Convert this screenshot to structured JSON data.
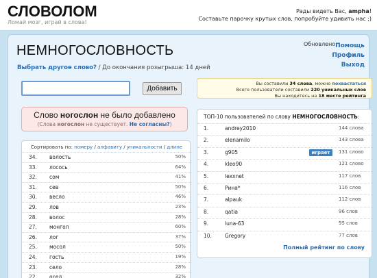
{
  "header": {
    "logo": "СЛОВОЛОМ",
    "slogan": "Ломай мозг, играй в слова!",
    "greet_line1": "Рады видеть Вас, ",
    "greet_user": "ampha",
    "greet_line1_end": "!",
    "greet_line2": "Составьте парочку крутых слов, попробуйте удивить нас ;)"
  },
  "game": {
    "word": "НЕМНОГОСЛОВНОСТЬ",
    "updated": "Обновлено",
    "links": [
      "Помощь",
      "Профиль",
      "Выход"
    ],
    "choose_other": "Выбрать другое слово?",
    "deadline": " / До окончания розыгрыша: 14 дней"
  },
  "input": {
    "value": "",
    "button_label": "Добавить"
  },
  "stats": {
    "line1_pre": "Вы составили ",
    "line1_count": "34 слова",
    "line1_mid": ", можно ",
    "line1_link": "похвастаться",
    "line2_pre": "Всего пользователи составили ",
    "line2_count": "220 уникальных слов",
    "line3_pre": "Вы находитесь на ",
    "line3_place": "18 месте рейтинга"
  },
  "error": {
    "pre": "Слово ",
    "word": "ногослон",
    "post": " не было добавлено",
    "sub_pre": "(Слова ",
    "sub_word": "ногослон",
    "sub_mid": " не существует. ",
    "sub_link": "Не согласны?",
    "sub_end": ")"
  },
  "sort": {
    "label": "Сортировать по: ",
    "options": [
      "номеру",
      "алфавиту",
      "уникальности",
      "длине"
    ],
    "sep": " / "
  },
  "words": [
    {
      "n": "34.",
      "w": "волость",
      "p": "50%"
    },
    {
      "n": "33.",
      "w": "лосось",
      "p": "64%"
    },
    {
      "n": "32.",
      "w": "сом",
      "p": "41%"
    },
    {
      "n": "31.",
      "w": "сев",
      "p": "50%"
    },
    {
      "n": "30.",
      "w": "весло",
      "p": "46%"
    },
    {
      "n": "29.",
      "w": "лов",
      "p": "23%"
    },
    {
      "n": "28.",
      "w": "волос",
      "p": "28%"
    },
    {
      "n": "27.",
      "w": "монгол",
      "p": "60%"
    },
    {
      "n": "26.",
      "w": "лог",
      "p": "37%"
    },
    {
      "n": "25.",
      "w": "мосол",
      "p": "50%"
    },
    {
      "n": "24.",
      "w": "гость",
      "p": "19%"
    },
    {
      "n": "23.",
      "w": "село",
      "p": "28%"
    },
    {
      "n": "22.",
      "w": "осел",
      "p": "32%"
    }
  ],
  "top": {
    "title_pre": "ТОП-10 пользователей по слову ",
    "title_word": "НЕМНОГОСЛОВНОСТЬ",
    "title_end": ":",
    "rows": [
      {
        "n": "1.",
        "u": "andrey2010",
        "c": "144 слова",
        "badge": ""
      },
      {
        "n": "2.",
        "u": "elenamilo",
        "c": "143 слова",
        "badge": ""
      },
      {
        "n": "3.",
        "u": "g905",
        "c": "131 слово",
        "badge": "играет"
      },
      {
        "n": "4.",
        "u": "kleo90",
        "c": "121 слово",
        "badge": ""
      },
      {
        "n": "5.",
        "u": "lexxnet",
        "c": "117 слов",
        "badge": ""
      },
      {
        "n": "6.",
        "u": "Рина*",
        "c": "116 слов",
        "badge": ""
      },
      {
        "n": "7.",
        "u": "alpauk",
        "c": "112 слов",
        "badge": ""
      },
      {
        "n": "8.",
        "u": "qatia",
        "c": "96 слов",
        "badge": ""
      },
      {
        "n": "9.",
        "u": "luna-63",
        "c": "95 слов",
        "badge": ""
      },
      {
        "n": "10.",
        "u": "Gregory",
        "c": "77 слов",
        "badge": ""
      }
    ],
    "full_link": "Полный рейтинг по слову"
  }
}
